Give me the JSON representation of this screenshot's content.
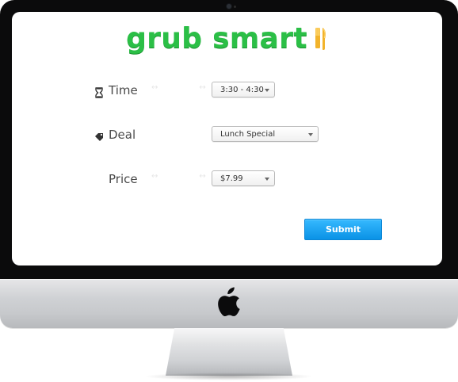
{
  "app": {
    "brand_text": "grub smart",
    "brand_color": "#2bbf46",
    "accent_color": "#12a2f2",
    "brand_icon": "fork-knife-icon"
  },
  "form": {
    "time": {
      "label": "Time",
      "icon": "hourglass-icon",
      "value": "3:30 - 4:30"
    },
    "deal": {
      "label": "Deal",
      "icon": "tag-icon",
      "value": "Lunch Special"
    },
    "price": {
      "label": "Price",
      "icon": "",
      "value": "$7.99"
    },
    "submit_label": "Submit"
  },
  "hardware": {
    "monitor_logo_icon": "apple-logo-icon"
  }
}
